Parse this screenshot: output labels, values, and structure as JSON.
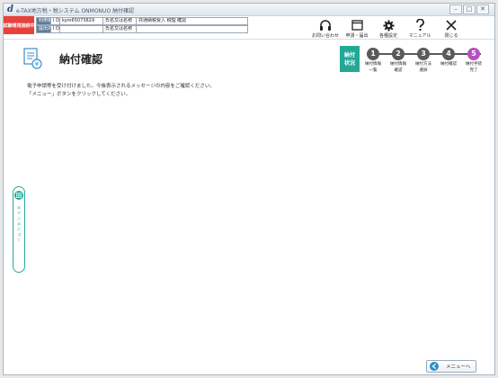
{
  "window": {
    "title": "e-TAX地方税・税システム  ONMONUO  納付確認",
    "controls": {
      "minimize": "–",
      "maximize": "□",
      "close": "✕"
    }
  },
  "env_badge": "試験環境接続中",
  "user_info": {
    "row1": {
      "label1": "利用者",
      "id_label": "I D",
      "id_value": "kym65073829",
      "label2": "氏名又は名称",
      "name_value": "共通納税受入 税理 確認"
    },
    "row2": {
      "label1": "提出先",
      "id_label": "I D",
      "id_value": "",
      "label2": "氏名又は名称",
      "name_value": ""
    }
  },
  "toolbar": [
    {
      "icon": "headset-icon",
      "label": "お問い合わせ"
    },
    {
      "icon": "window-icon",
      "label": "申請・届出"
    },
    {
      "icon": "gear-icon",
      "label": "各種設定"
    },
    {
      "icon": "question-icon",
      "label": "マニュアル"
    },
    {
      "icon": "close-x-icon",
      "label": "閉じる"
    }
  ],
  "page": {
    "title": "納付確認",
    "message_line1": "電子申請等を受け付けました。今後表示されるメッセージの内容をご確認ください。",
    "message_line2": "「メニュー」ボタンをクリックしてください。"
  },
  "steps": {
    "current": {
      "line1": "納付",
      "line2": "状況"
    },
    "items": [
      {
        "num": "1",
        "line1": "納付情報",
        "line2": "一覧"
      },
      {
        "num": "2",
        "line1": "納付情報",
        "line2": "確認"
      },
      {
        "num": "3",
        "line1": "納付方法",
        "line2": "選択"
      },
      {
        "num": "4",
        "line1": "納付確認",
        "line2": ""
      },
      {
        "num": "5",
        "line1": "納付手続",
        "line2": "完了"
      }
    ],
    "active_index": 4
  },
  "side_menu": {
    "label": "メインメニュー"
  },
  "menu_button": {
    "label": "メニューへ"
  },
  "colors": {
    "accent": "#24a896",
    "env_badge": "#e8403c",
    "active_step": "#b74fc0",
    "label_bg": "#5c7d9c"
  }
}
